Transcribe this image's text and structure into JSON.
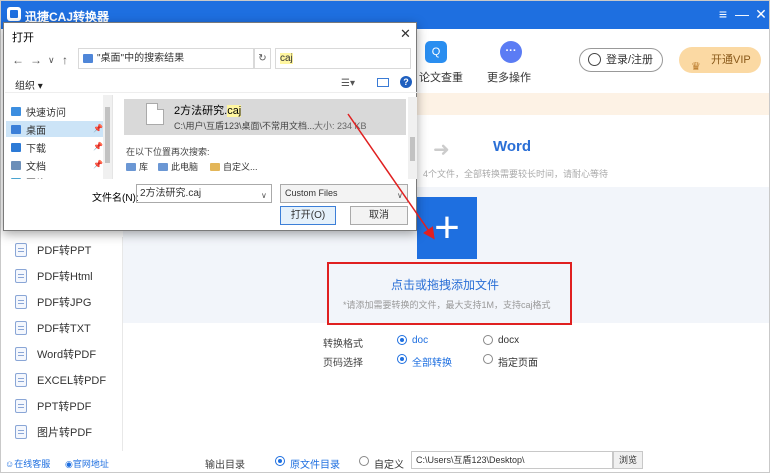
{
  "app": {
    "title": "迅捷CAJ转换器",
    "window_controls": {
      "menu": "≡",
      "minimize": "—",
      "close": "✕"
    },
    "nav": {
      "check_label": "论文查重",
      "more_label": "更多操作"
    },
    "login_label": "登录/注册",
    "vip_label": "开通VIP"
  },
  "sidebar": {
    "items": [
      {
        "label": "PDF转PPT"
      },
      {
        "label": "PDF转Html"
      },
      {
        "label": "PDF转JPG"
      },
      {
        "label": "PDF转TXT"
      },
      {
        "label": "Word转PDF"
      },
      {
        "label": "EXCEL转PDF"
      },
      {
        "label": "PPT转PDF"
      },
      {
        "label": "图片转PDF"
      }
    ],
    "footer": {
      "service": "在线客服",
      "website": "官网地址"
    }
  },
  "main": {
    "target_format": "Word",
    "hint_top": "4个文件，全部转换需要较长时间，请耐心等待",
    "add_label": "点击或拖拽添加文件",
    "add_hint": "*请添加需要转换的文件，最大支持1M，支持caj格式",
    "format_label": "转换格式",
    "format_options": [
      "doc",
      "docx"
    ],
    "format_selected": "doc",
    "page_label": "页码选择",
    "page_options": [
      "全部转换",
      "指定页面"
    ],
    "page_selected": "全部转换",
    "output_label": "输出目录",
    "output_options": [
      "原文件目录",
      "自定义"
    ],
    "output_selected": "原文件目录",
    "output_path": "C:\\Users\\互盾123\\Desktop\\",
    "browse_label": "浏览"
  },
  "dialog": {
    "title": "打开",
    "close": "✕",
    "address": "\"桌面\"中的搜索结果",
    "search_value": "caj",
    "organize_label": "组织 ▾",
    "tree": [
      {
        "label": "快速访问"
      },
      {
        "label": "桌面"
      },
      {
        "label": "下载"
      },
      {
        "label": "文档"
      },
      {
        "label": "图片"
      }
    ],
    "result": {
      "name_prefix": "2方法研究.",
      "name_match": "caj",
      "path": "C:\\用户\\互盾123\\桌面\\不常用文档...",
      "size_label": "大小: 234 KB"
    },
    "search_again": "在以下位置再次搜索:",
    "locations": [
      "库",
      "此电脑",
      "自定义..."
    ],
    "filename_label": "文件名(N):",
    "filename_value": "2方法研究.caj",
    "filter_value": "Custom Files",
    "open_label": "打开(O)",
    "cancel_label": "取消"
  },
  "colors": {
    "accent": "#1e6fe0",
    "highlight": "#e02020",
    "vip": "#fbd9a3"
  }
}
